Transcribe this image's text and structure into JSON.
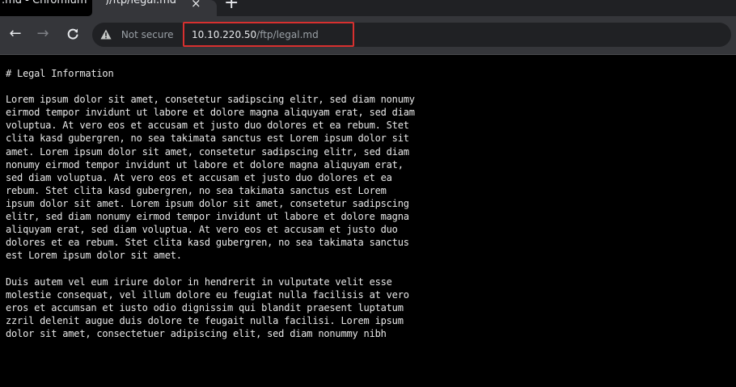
{
  "browser": {
    "tab": {
      "tooltip_fragment": ".md - Chromium",
      "title_fragment": ")/ftp/legal.md",
      "close_glyph": "×",
      "new_tab_glyph": "+"
    },
    "toolbar": {
      "back_glyph": "←",
      "forward_glyph": "→",
      "reload_glyph": "C",
      "security_label": "Not secure",
      "url_host": "10.10.220.50",
      "url_path": "/ftp/legal.md",
      "highlight_color": "#d8302f"
    }
  },
  "document": {
    "lines": [
      "# Legal Information",
      "",
      "Lorem ipsum dolor sit amet, consetetur sadipscing elitr, sed diam nonumy",
      "eirmod tempor invidunt ut labore et dolore magna aliquyam erat, sed diam",
      "voluptua. At vero eos et accusam et justo duo dolores et ea rebum. Stet",
      "clita kasd gubergren, no sea takimata sanctus est Lorem ipsum dolor sit",
      "amet. Lorem ipsum dolor sit amet, consetetur sadipscing elitr, sed diam",
      "nonumy eirmod tempor invidunt ut labore et dolore magna aliquyam erat,",
      "sed diam voluptua. At vero eos et accusam et justo duo dolores et ea",
      "rebum. Stet clita kasd gubergren, no sea takimata sanctus est Lorem",
      "ipsum dolor sit amet. Lorem ipsum dolor sit amet, consetetur sadipscing",
      "elitr, sed diam nonumy eirmod tempor invidunt ut labore et dolore magna",
      "aliquyam erat, sed diam voluptua. At vero eos et accusam et justo duo",
      "dolores et ea rebum. Stet clita kasd gubergren, no sea takimata sanctus",
      "est Lorem ipsum dolor sit amet.",
      "",
      "Duis autem vel eum iriure dolor in hendrerit in vulputate velit esse",
      "molestie consequat, vel illum dolore eu feugiat nulla facilisis at vero",
      "eros et accumsan et iusto odio dignissim qui blandit praesent luptatum",
      "zzril delenit augue duis dolore te feugait nulla facilisi. Lorem ipsum",
      "dolor sit amet, consectetuer adipiscing elit, sed diam nonummy nibh"
    ]
  }
}
